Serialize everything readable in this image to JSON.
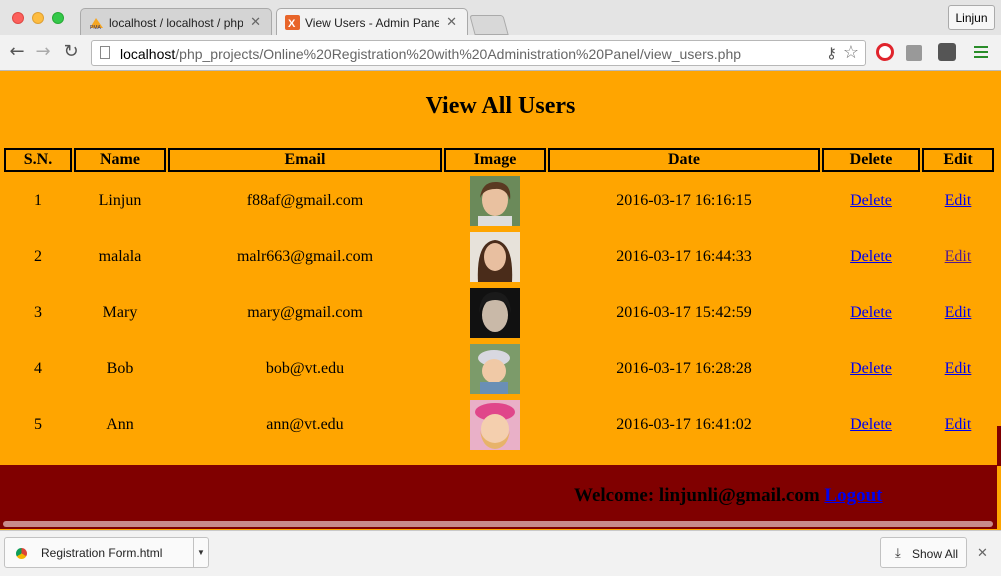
{
  "browser": {
    "tabs": [
      {
        "title": "localhost / localhost / php",
        "favicon": "phpmyadmin-icon",
        "active": false
      },
      {
        "title": "View Users - Admin Panel",
        "favicon": "xampp-icon",
        "active": true
      }
    ],
    "profile_label": "Linjun",
    "url_host": "localhost",
    "url_path": "/php_projects/Online%20Registration%20with%20Administration%20Panel/view_users.php"
  },
  "page": {
    "title": "View All Users",
    "table": {
      "headers": [
        "S.N.",
        "Name",
        "Email",
        "Image",
        "Date",
        "Delete",
        "Edit"
      ],
      "rows": [
        {
          "sn": "1",
          "name": "Linjun",
          "email": "f88af@gmail.com",
          "date": "2016-03-17 16:16:15",
          "delete": "Delete",
          "edit": "Edit"
        },
        {
          "sn": "2",
          "name": "malala",
          "email": "malr663@gmail.com",
          "date": "2016-03-17 16:44:33",
          "delete": "Delete",
          "edit": "Edit"
        },
        {
          "sn": "3",
          "name": "Mary",
          "email": "mary@gmail.com",
          "date": "2016-03-17 15:42:59",
          "delete": "Delete",
          "edit": "Edit"
        },
        {
          "sn": "4",
          "name": "Bob",
          "email": "bob@vt.edu",
          "date": "2016-03-17 16:28:28",
          "delete": "Delete",
          "edit": "Edit"
        },
        {
          "sn": "5",
          "name": "Ann",
          "email": "ann@vt.edu",
          "date": "2016-03-17 16:41:02",
          "delete": "Delete",
          "edit": "Edit"
        }
      ]
    },
    "footer": {
      "welcome": "Welcome: linjunli@gmail.com",
      "logout": "Logout"
    }
  },
  "downloads": {
    "file": "Registration Form.html",
    "show_all": "Show All"
  },
  "colors": {
    "page_bg": "#ffa500",
    "footer_bg": "#800000",
    "link": "#0000ee"
  }
}
